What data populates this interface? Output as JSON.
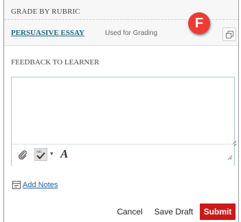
{
  "rubric": {
    "section_title": "GRADE BY RUBRIC",
    "rubric_name": "PERSUASIVE ESSAY",
    "status": "Used for Grading",
    "grade_letter": "F",
    "expand_icon": "expand-window-icon"
  },
  "feedback": {
    "label": "FEEDBACK TO LEARNER",
    "value": "",
    "toolbar": {
      "attach_icon": "paperclip-icon",
      "spellcheck_icon": "spellcheck-icon",
      "spellcheck_menu_caret": "▾",
      "format_label": "A"
    }
  },
  "notes": {
    "add_notes_label": "Add Notes",
    "icon": "note-icon"
  },
  "actions": {
    "cancel_label": "Cancel",
    "save_draft_label": "Save Draft",
    "submit_label": "Submit"
  },
  "colors": {
    "badge": "#ee3b34",
    "submit": "#cc1a1a",
    "link": "#1a6a8a"
  }
}
